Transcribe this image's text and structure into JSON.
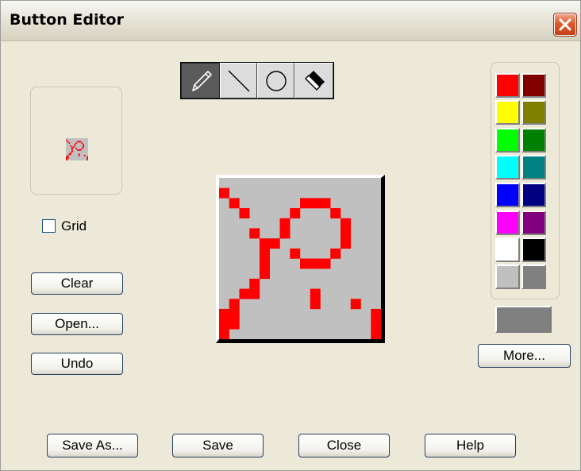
{
  "window": {
    "title": "Button Editor"
  },
  "grid": {
    "label": "Grid",
    "checked": false
  },
  "buttons": {
    "clear": "Clear",
    "open": "Open...",
    "undo": "Undo",
    "more": "More...",
    "save_as": "Save As...",
    "save": "Save",
    "close": "Close",
    "help": "Help"
  },
  "tools": [
    {
      "name": "pencil-icon",
      "active": true
    },
    {
      "name": "line-icon",
      "active": false
    },
    {
      "name": "circle-icon",
      "active": false
    },
    {
      "name": "eraser-icon",
      "active": false
    }
  ],
  "colors": {
    "drawing": "#ff0000",
    "canvas_background": "#c0c0c0",
    "current": "#808080"
  },
  "palette": [
    [
      "#ff0000",
      "#800000"
    ],
    [
      "#ffff00",
      "#808000"
    ],
    [
      "#00ff00",
      "#008000"
    ],
    [
      "#00ffff",
      "#008080"
    ],
    [
      "#0000ff",
      "#000080"
    ],
    [
      "#ff00ff",
      "#800080"
    ],
    [
      "#ffffff",
      "#000000"
    ],
    [
      "#c0c0c0",
      "#808080"
    ]
  ],
  "pixel_grid": {
    "size": 16,
    "rows": [
      "................",
      "X...............",
      ".X......XXX.....",
      "..X....X...X....",
      "......X.....X...",
      "...X..X.....X...",
      "....XX......X...",
      "....X..X...X....",
      "....X...XXX.....",
      "....X...........",
      "...X............",
      "..XX.....X......",
      ".X.......X...X..",
      "XX.............X",
      "XX.............X",
      "X..............X"
    ]
  }
}
